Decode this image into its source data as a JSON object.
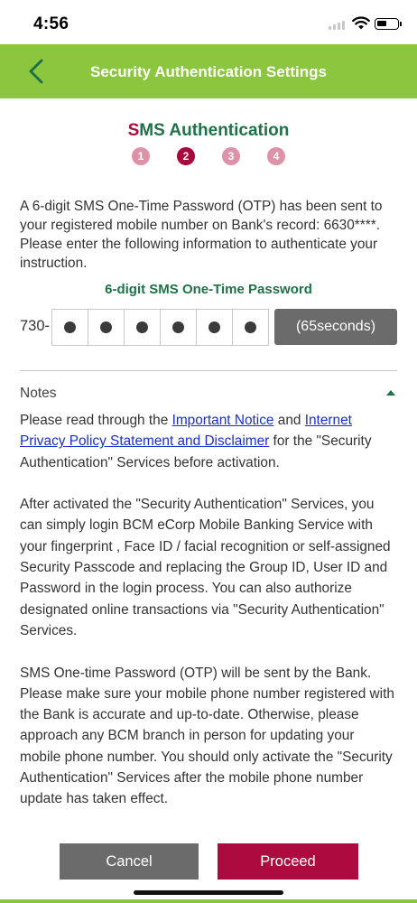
{
  "status_bar": {
    "time": "4:56"
  },
  "header": {
    "title": "Security Authentication Settings",
    "back_icon": "chevron-left-icon"
  },
  "step_header": {
    "title_first": "S",
    "title_rest": "MS Authentication",
    "steps": [
      "1",
      "2",
      "3",
      "4"
    ],
    "active_step": "2"
  },
  "intro_text": "A 6-digit SMS One-Time Password (OTP) has been sent to your registered mobile number on Bank's record: 6630****. Please enter the following information to authenticate your instruction.",
  "otp": {
    "label": "6-digit SMS One-Time Password",
    "prefix": "730-",
    "digits_entered": 6,
    "resend_label": "(65seconds)"
  },
  "notes": {
    "title": "Notes",
    "p1_before": "Please read through the ",
    "link1": "Important Notice",
    "p1_middle": " and ",
    "link2": "Internet Privacy Policy Statement and Disclaimer",
    "p1_after": " for the \"Security Authentication\" Services before activation.",
    "p2": "After activated the \"Security Authentication\" Services, you can simply login BCM eCorp Mobile Banking Service with your fingerprint , Face ID / facial recognition or self-assigned Security Passcode and replacing the Group ID, User ID and Password in the login process. You can also authorize designated online transactions via \"Security Authentication\" Services.",
    "p3": "SMS One-time Password (OTP) will be sent by the Bank. Please make sure your mobile phone number registered with the Bank is accurate and up-to-date. Otherwise, please approach any BCM branch in person for updating your mobile phone number. You should only activate the \"Security Authentication\" Services after the mobile phone number update has taken effect."
  },
  "buttons": {
    "cancel": "Cancel",
    "proceed": "Proceed"
  },
  "colors": {
    "header_green": "#8cc63f",
    "brand_red": "#ad0a3f",
    "title_green": "#1e7148",
    "button_gray": "#6b6b6b"
  }
}
